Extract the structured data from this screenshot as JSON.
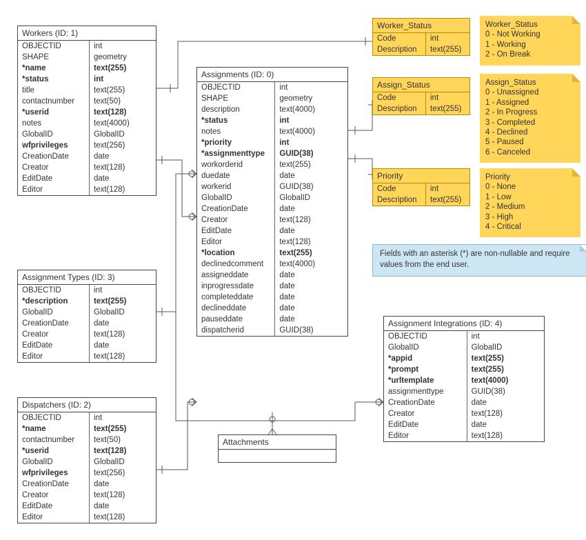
{
  "entities": {
    "workers": {
      "title": "Workers (ID: 1)",
      "rows": [
        {
          "name": "OBJECTID",
          "type": "int"
        },
        {
          "name": "SHAPE",
          "type": "geometry"
        },
        {
          "name": "*name",
          "type": "text(255)",
          "bold": true
        },
        {
          "name": "*status",
          "type": "int",
          "bold": true
        },
        {
          "name": "title",
          "type": "text(255)"
        },
        {
          "name": "contactnumber",
          "type": "text(50)"
        },
        {
          "name": "*userid",
          "type": "text(128)",
          "bold": true
        },
        {
          "name": "notes",
          "type": "text(4000)"
        },
        {
          "name": "GlobalID",
          "type": "GlobalID"
        },
        {
          "name": "wfprivileges",
          "type": "text(256)",
          "boldName": true
        },
        {
          "name": "CreationDate",
          "type": "date"
        },
        {
          "name": "Creator",
          "type": "text(128)"
        },
        {
          "name": "EditDate",
          "type": "date"
        },
        {
          "name": "Editor",
          "type": "text(128)"
        }
      ]
    },
    "assignmentTypes": {
      "title": "Assignment Types (ID: 3)",
      "rows": [
        {
          "name": "OBJECTID",
          "type": "int"
        },
        {
          "name": "*description",
          "type": "text(255)",
          "bold": true
        },
        {
          "name": "GlobalID",
          "type": "GlobalID"
        },
        {
          "name": "CreationDate",
          "type": "date"
        },
        {
          "name": "Creator",
          "type": "text(128)"
        },
        {
          "name": "EditDate",
          "type": "date"
        },
        {
          "name": "Editor",
          "type": "text(128)"
        }
      ]
    },
    "dispatchers": {
      "title": "Dispatchers (ID: 2)",
      "rows": [
        {
          "name": "OBJECTID",
          "type": "int"
        },
        {
          "name": "*name",
          "type": "text(255)",
          "bold": true
        },
        {
          "name": "contactnumber",
          "type": "text(50)"
        },
        {
          "name": "*userid",
          "type": "text(128)",
          "bold": true
        },
        {
          "name": "GlobalID",
          "type": "GlobalID"
        },
        {
          "name": "wfprivileges",
          "type": "text(256)",
          "boldName": true
        },
        {
          "name": "CreationDate",
          "type": "date"
        },
        {
          "name": "Creator",
          "type": "text(128)"
        },
        {
          "name": "EditDate",
          "type": "date"
        },
        {
          "name": "Editor",
          "type": "text(128)"
        }
      ]
    },
    "assignments": {
      "title": "Assignments (ID: 0)",
      "rows": [
        {
          "name": "OBJECTID",
          "type": "int"
        },
        {
          "name": "SHAPE",
          "type": "geometry"
        },
        {
          "name": "description",
          "type": "text(4000)"
        },
        {
          "name": "*status",
          "type": "int",
          "bold": true
        },
        {
          "name": "notes",
          "type": "text(4000)"
        },
        {
          "name": "*priority",
          "type": "int",
          "bold": true
        },
        {
          "name": "*assignmenttype",
          "type": "GUID(38)",
          "bold": true
        },
        {
          "name": "workorderid",
          "type": "text(255)"
        },
        {
          "name": "duedate",
          "type": "date"
        },
        {
          "name": "workerid",
          "type": "GUID(38)"
        },
        {
          "name": "GlobalID",
          "type": "GlobalID"
        },
        {
          "name": "CreationDate",
          "type": "date"
        },
        {
          "name": "Creator",
          "type": "text(128)"
        },
        {
          "name": "EditDate",
          "type": "date"
        },
        {
          "name": "Editor",
          "type": "text(128)"
        },
        {
          "name": "*location",
          "type": "text(255)",
          "bold": true
        },
        {
          "name": "declinedcomment",
          "type": "text(4000)"
        },
        {
          "name": "assigneddate",
          "type": "date"
        },
        {
          "name": "inprogressdate",
          "type": "date"
        },
        {
          "name": "completeddate",
          "type": "date"
        },
        {
          "name": "declineddate",
          "type": "date"
        },
        {
          "name": "pauseddate",
          "type": "date"
        },
        {
          "name": "dispatcherid",
          "type": "GUID(38)"
        }
      ]
    },
    "attachments": {
      "title": "Attachments"
    },
    "assignmentIntegrations": {
      "title": "Assignment Integrations (ID: 4)",
      "rows": [
        {
          "name": "OBJECTID",
          "type": "int"
        },
        {
          "name": "GlobalID",
          "type": "GlobalID"
        },
        {
          "name": "*appid",
          "type": "text(255)",
          "bold": true
        },
        {
          "name": "*prompt",
          "type": "text(255)",
          "bold": true
        },
        {
          "name": "*urltemplate",
          "type": "text(4000)",
          "bold": true
        },
        {
          "name": "assignmenttype",
          "type": "GUID(38)"
        },
        {
          "name": "CreationDate",
          "type": "date"
        },
        {
          "name": "Creator",
          "type": "text(128)"
        },
        {
          "name": "EditDate",
          "type": "date"
        },
        {
          "name": "Editor",
          "type": "text(128)"
        }
      ]
    }
  },
  "lookups": {
    "workerStatus": {
      "title": "Worker_Status",
      "rows": [
        {
          "name": "Code",
          "type": "int"
        },
        {
          "name": "Description",
          "type": "text(255)"
        }
      ]
    },
    "assignStatus": {
      "title": "Assign_Status",
      "rows": [
        {
          "name": "Code",
          "type": "int"
        },
        {
          "name": "Description",
          "type": "text(255)"
        }
      ]
    },
    "priority": {
      "title": "Priority",
      "rows": [
        {
          "name": "Code",
          "type": "int"
        },
        {
          "name": "Description",
          "type": "text(255)"
        }
      ]
    }
  },
  "notes": {
    "workerStatus": {
      "title": "Worker_Status",
      "lines": [
        "0 - Not Working",
        "1 - Working",
        "2 - On Break"
      ]
    },
    "assignStatus": {
      "title": "Assign_Status",
      "lines": [
        "0 - Unassigned",
        "1 - Assigned",
        "2 - In Progress",
        "3 - Completed",
        "4 - Declined",
        "5 - Paused",
        "6 - Canceled"
      ]
    },
    "priority": {
      "title": "Priority",
      "lines": [
        "0 - None",
        "1 - Low",
        "2 - Medium",
        "3 - High",
        "4 - Critical"
      ]
    }
  },
  "infoText": "Fields with an asterisk (*) are non-nullable and require values from the end user."
}
